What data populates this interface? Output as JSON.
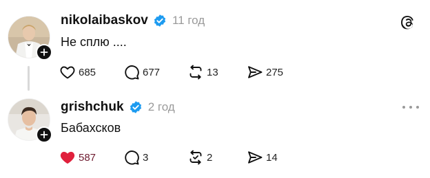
{
  "colors": {
    "text": "#111111",
    "muted": "#9a9a9a",
    "verified": "#1d9bf0",
    "liked_heart": "#e0203c",
    "liked_count": "#6e1a2f"
  },
  "icons": {
    "app_logo": "threads-logo-icon",
    "more": "more-horizontal-icon",
    "like": "heart-icon",
    "reply": "comment-bubble-icon",
    "repost": "repost-icon",
    "share": "send-icon",
    "verified": "verified-badge-icon",
    "follow": "plus-icon"
  },
  "posts": [
    {
      "username": "nikolaibaskov",
      "time": "11 год",
      "text": "Не сплю ....",
      "liked": false,
      "stats": {
        "likes": "685",
        "replies": "677",
        "reposts": "13",
        "shares": "275"
      }
    },
    {
      "username": "grishchuk",
      "time": "2 год",
      "text": "Бабахсков",
      "liked": true,
      "stats": {
        "likes": "587",
        "replies": "3",
        "reposts": "2",
        "shares": "14"
      }
    }
  ]
}
